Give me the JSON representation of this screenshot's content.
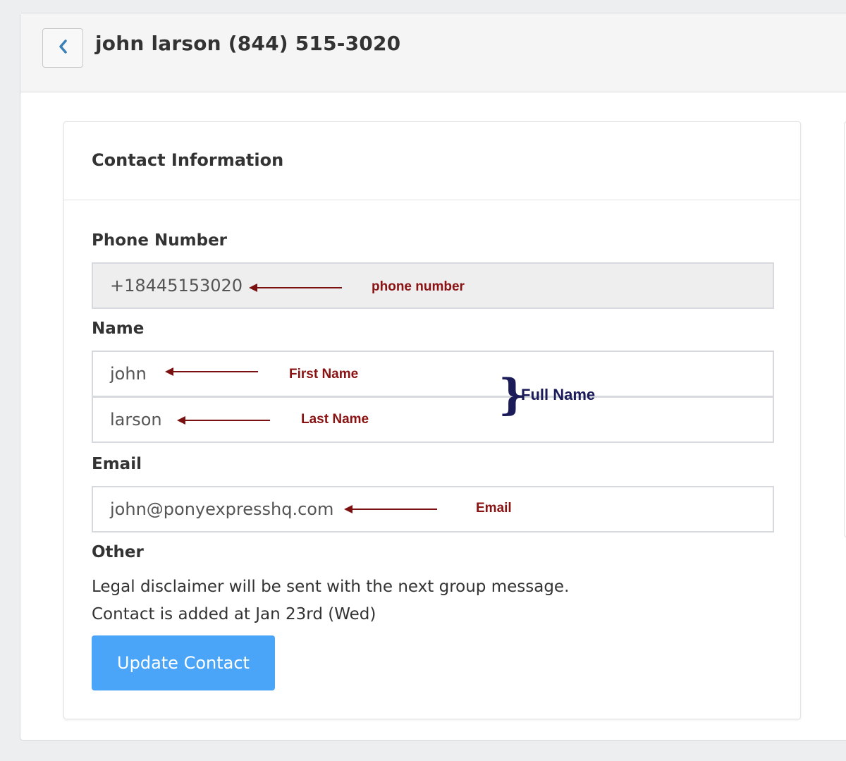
{
  "header": {
    "back_icon": "chevron-left-icon",
    "title": "john larson (844) 515-3020"
  },
  "card": {
    "title": "Contact Information",
    "phone": {
      "label": "Phone Number",
      "value": "+18445153020",
      "annotation": "phone number"
    },
    "name": {
      "label": "Name",
      "first_value": "john",
      "first_annotation": "First Name",
      "last_value": "larson",
      "last_annotation": "Last Name",
      "full_annotation": "Full Name"
    },
    "email": {
      "label": "Email",
      "value": "john@ponyexpresshq.com",
      "annotation": "Email"
    },
    "other": {
      "label": "Other",
      "line1": "Legal disclaimer will be sent with the next group message.",
      "line2": "Contact is added at Jan 23rd (Wed)"
    },
    "update_button": "Update Contact"
  },
  "colors": {
    "accent": "#4aa5f8",
    "annotation": "#8a1212",
    "brace": "#1b1b5a"
  }
}
